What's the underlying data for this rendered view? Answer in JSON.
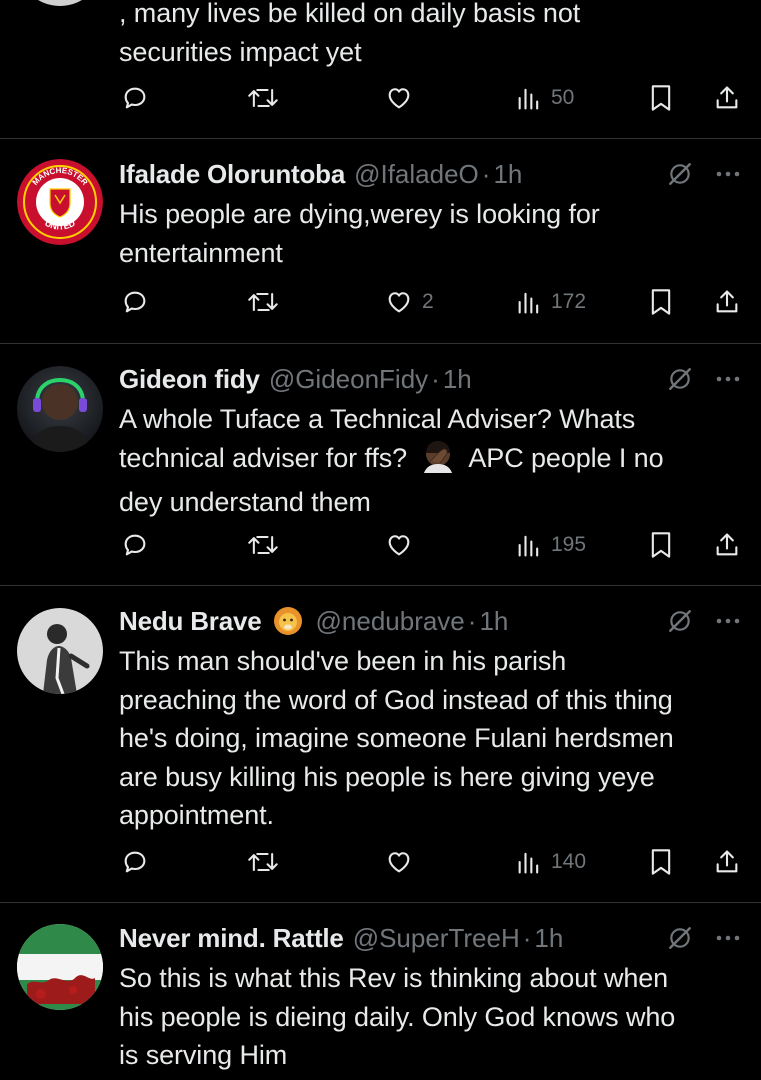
{
  "tweets": [
    {
      "id": "t0",
      "name": "",
      "handle": "",
      "time": "",
      "text": ", many lives be killed on daily basis not securities impact yet",
      "lines": [
        ", many lives be killed on daily basis not",
        "securities impact yet"
      ],
      "likes": "",
      "views": "50"
    },
    {
      "id": "t1",
      "name": "Ifalade Oloruntoba",
      "handle": "@IfaladeO",
      "time": "1h",
      "lines": [
        "His people are dying,werey is looking for",
        "entertainment"
      ],
      "likes": "2",
      "views": "172",
      "avatar": "manchester-united-crest",
      "avatar_text_top": "MANCHESTER",
      "avatar_text_bottom": "UNITED"
    },
    {
      "id": "t2",
      "name": "Gideon fidy",
      "handle": "@GideonFidy",
      "time": "1h",
      "lines_before_emoji": "A whole Tuface a Technical Adviser? Whats",
      "line2_a": "technical adviser for ffs?",
      "line2_b": "APC people I no",
      "line3": "dey understand them",
      "emoji": "face-palm-emoji",
      "likes": "",
      "views": "195",
      "avatar": "photo-man-headphones"
    },
    {
      "id": "t3",
      "name": "Nedu Brave",
      "handle": "@nedubrave",
      "time": "1h",
      "badge": "lion-emoji",
      "lines": [
        "This man should've been in his parish",
        "preaching the word of God instead of this thing",
        "he's doing, imagine someone Fulani herdsmen",
        "are busy killing his people is here giving yeye",
        "appointment."
      ],
      "likes": "",
      "views": "140",
      "avatar": "photo-man-bw"
    },
    {
      "id": "t4",
      "name": "Never mind. Rattle",
      "handle": "@SuperTreeH",
      "time": "1h",
      "lines": [
        "So this is what this Rev is thinking about when",
        "his people is dieing daily. Only God knows who",
        "is serving Him"
      ],
      "avatar": "photo-flag-blood"
    }
  ],
  "separator": "·",
  "colors": {
    "background": "#000000",
    "text": "#e7e9ea",
    "muted": "#71767b",
    "divider": "#2f3336"
  }
}
